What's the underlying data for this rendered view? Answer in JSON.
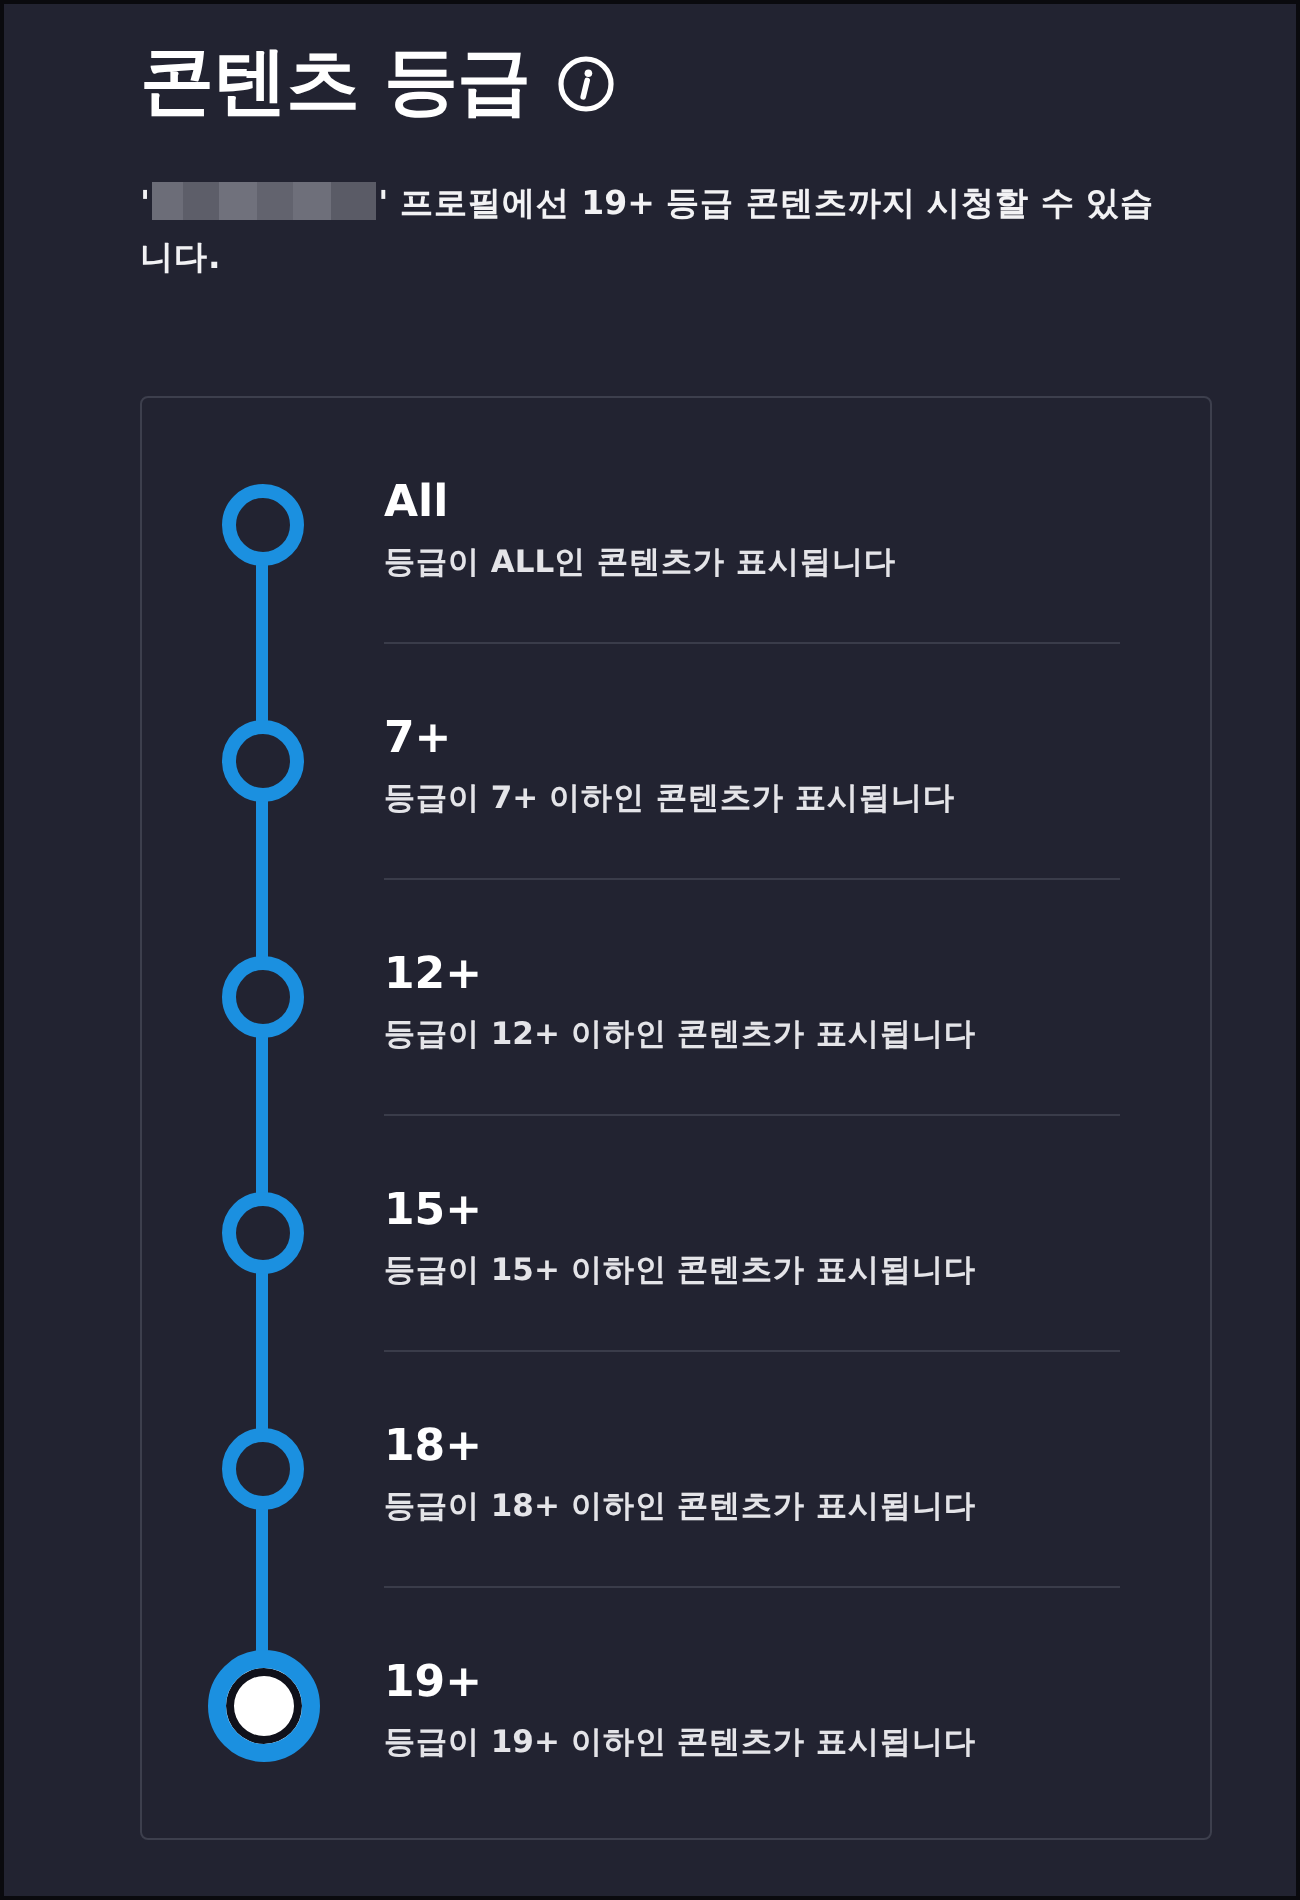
{
  "page": {
    "title": "콘텐츠 등급"
  },
  "notice": {
    "before": "'",
    "after": "' 프로필에선 19+ 등급 콘텐츠까지 시청할 수 있습니다."
  },
  "levels": [
    {
      "label": "All",
      "description": "등급이 ALL인 콘텐츠가 표시됩니다",
      "selected": false
    },
    {
      "label": "7+",
      "description": "등급이 7+ 이하인 콘텐츠가 표시됩니다",
      "selected": false
    },
    {
      "label": "12+",
      "description": "등급이 12+ 이하인 콘텐츠가 표시됩니다",
      "selected": false
    },
    {
      "label": "15+",
      "description": "등급이 15+ 이하인 콘텐츠가 표시됩니다",
      "selected": false
    },
    {
      "label": "18+",
      "description": "등급이 18+ 이하인 콘텐츠가 표시됩니다",
      "selected": false
    },
    {
      "label": "19+",
      "description": "등급이 19+ 이하인 콘텐츠가 표시됩니다",
      "selected": true
    }
  ]
}
